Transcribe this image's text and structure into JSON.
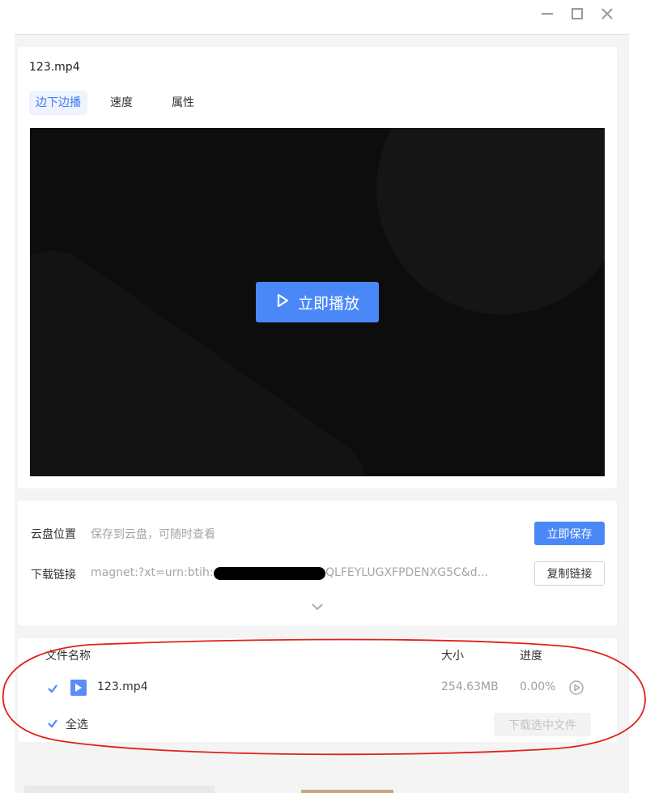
{
  "window": {
    "minimize_icon": "minimize-icon",
    "maximize_icon": "maximize-icon",
    "close_icon": "close-icon"
  },
  "file": {
    "title": "123.mp4"
  },
  "tabs": [
    {
      "label": "边下边播",
      "active": true
    },
    {
      "label": "速度",
      "active": false
    },
    {
      "label": "属性",
      "active": false
    }
  ],
  "player": {
    "play_label": "立即播放"
  },
  "cloud": {
    "label": "云盘位置",
    "hint": "保存到云盘，可随时查看",
    "save_button": "立即保存"
  },
  "link": {
    "label": "下载链接",
    "prefix": "magnet:?xt=urn:btih:",
    "suffix": "QLFEYLUGXFPDENXG5C&d...",
    "copy_button": "复制链接"
  },
  "files_table": {
    "columns": [
      "文件名称",
      "大小",
      "进度"
    ],
    "rows": [
      {
        "name": "123.mp4",
        "size": "254.63MB",
        "progress": "0.00%",
        "checked": true
      }
    ],
    "select_all_label": "全选",
    "download_selected_button": "下载选中文件"
  },
  "colors": {
    "accent": "#4b88f7",
    "annotation": "#e0211a"
  }
}
